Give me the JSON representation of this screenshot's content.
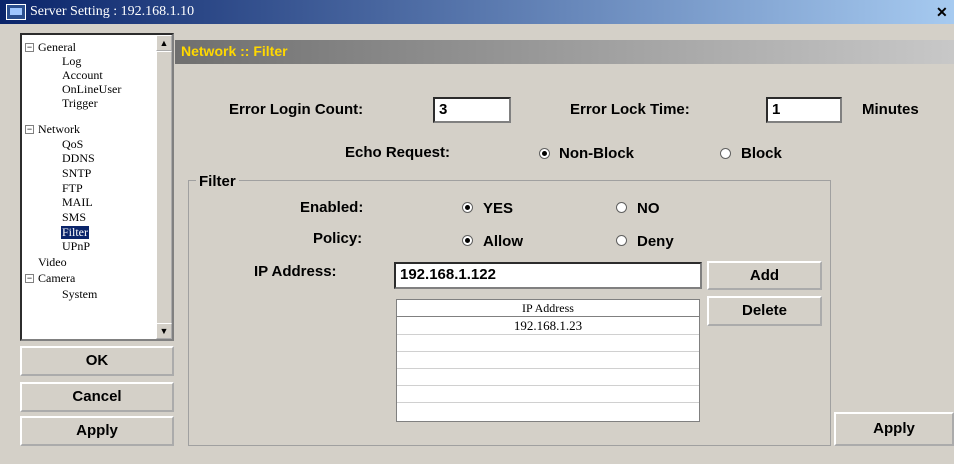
{
  "window": {
    "title": "Server Setting : 192.168.1.10",
    "close_symbol": "✕"
  },
  "tree": {
    "general": "General",
    "log": "Log",
    "account": "Account",
    "onlineuser": "OnLineUser",
    "trigger": "Trigger",
    "network": "Network",
    "qos": "QoS",
    "ddns": "DDNS",
    "sntp": "SNTP",
    "ftp": "FTP",
    "mail": "MAIL",
    "sms": "SMS",
    "filter": "Filter",
    "upnp": "UPnP",
    "video": "Video",
    "camera": "Camera",
    "system": "System",
    "expander": "−",
    "selected": "Filter"
  },
  "buttons": {
    "ok": "OK",
    "cancel": "Cancel",
    "apply_left": "Apply",
    "apply_right": "Apply",
    "add": "Add",
    "delete": "Delete"
  },
  "header": {
    "title": "Network :: Filter",
    "accent": "#ffd800"
  },
  "form": {
    "error_login_count_label": "Error Login Count:",
    "error_login_count_value": "3",
    "error_lock_time_label": "Error Lock Time:",
    "error_lock_time_value": "1",
    "minutes_label": "Minutes",
    "echo_request_label": "Echo Request:",
    "echo_non_block": "Non-Block",
    "echo_block": "Block",
    "echo_selected": "Non-Block"
  },
  "filter": {
    "group_label": "Filter",
    "enabled_label": "Enabled:",
    "enabled_yes": "YES",
    "enabled_no": "NO",
    "enabled_selected": "YES",
    "policy_label": "Policy:",
    "policy_allow": "Allow",
    "policy_deny": "Deny",
    "policy_selected": "Allow",
    "ip_label": "IP Address:",
    "ip_value": "192.168.1.122",
    "table_header": "IP Address",
    "table_rows": [
      "192.168.1.23"
    ]
  },
  "icons": [
    "app-icon",
    "close-icon",
    "scroll-up-icon",
    "scroll-down-icon"
  ]
}
